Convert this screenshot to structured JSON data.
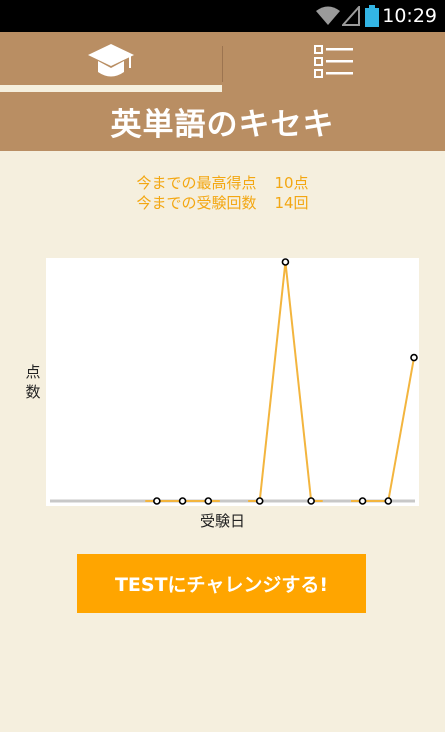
{
  "status_bar": {
    "time": "10:29"
  },
  "tabs": [
    {
      "icon": "graduation-cap-icon"
    },
    {
      "icon": "checklist-icon"
    }
  ],
  "header": {
    "title": "英単語のキセキ"
  },
  "stats": {
    "best_score_label": "今までの最高得点",
    "best_score_value": "10点",
    "test_count_label": "今までの受験回数",
    "test_count_value": "14回"
  },
  "chart_data": {
    "type": "line",
    "ylabel": "点数",
    "xlabel": "受験日",
    "ylim": [
      0,
      10
    ],
    "series": [
      {
        "values": [
          null,
          null,
          null,
          null,
          0,
          0,
          0,
          null,
          0,
          10,
          0,
          null,
          0,
          0,
          6
        ]
      }
    ]
  },
  "actions": {
    "test_button_label": "TESTにチャレンジする!"
  },
  "colors": {
    "accent": "#ffa500",
    "header": "#b98e63",
    "background": "#f5efde",
    "line": "#f3b53e"
  }
}
